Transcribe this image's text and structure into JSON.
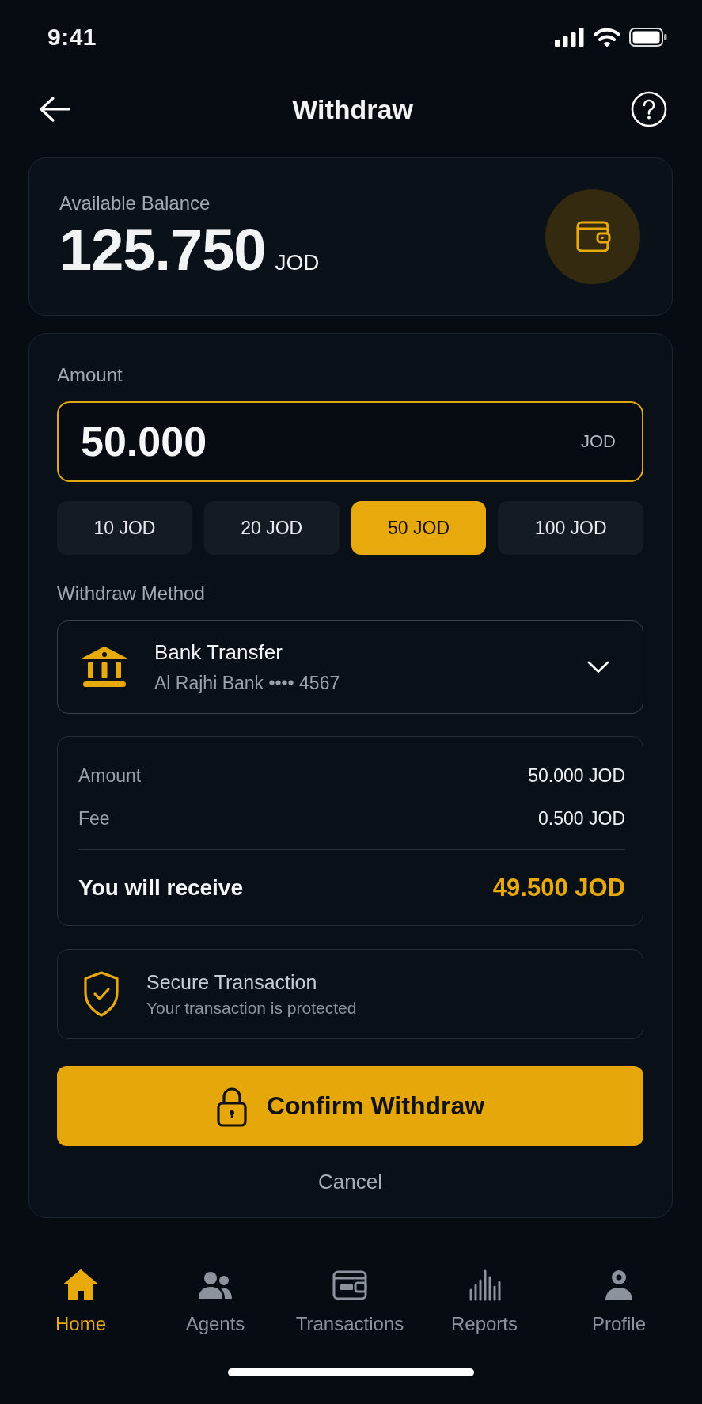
{
  "status_bar": {
    "time": "9:41"
  },
  "header": {
    "title": "Withdraw"
  },
  "balance": {
    "label": "Available Balance",
    "amount": "125.750",
    "currency": "JOD"
  },
  "amount": {
    "label": "Amount",
    "value": "50.000",
    "currency": "JOD"
  },
  "quick_amounts": [
    {
      "label": "10 JOD",
      "selected": false
    },
    {
      "label": "20 JOD",
      "selected": false
    },
    {
      "label": "50 JOD",
      "selected": true
    },
    {
      "label": "100 JOD",
      "selected": false
    }
  ],
  "method": {
    "label": "Withdraw Method",
    "name": "Bank Transfer",
    "account": "Al Rajhi Bank •••• 4567"
  },
  "summary": {
    "rows": [
      {
        "kind": "line",
        "label": "Amount",
        "value": "50.000 JOD"
      },
      {
        "kind": "line",
        "label": "Fee",
        "value": "0.500 JOD"
      },
      {
        "kind": "total",
        "label": "You will receive",
        "value": "49.500 JOD"
      }
    ]
  },
  "security": {
    "title": "Secure Transaction",
    "subtitle": "Your transaction is protected"
  },
  "actions": {
    "confirm": "Confirm Withdraw",
    "cancel": "Cancel"
  },
  "nav": [
    {
      "kind": "home",
      "label": "Home",
      "selected": true
    },
    {
      "kind": "agents",
      "label": "Agents",
      "selected": false
    },
    {
      "kind": "transactions",
      "label": "Transactions",
      "selected": false
    },
    {
      "kind": "reports",
      "label": "Reports",
      "selected": false
    },
    {
      "kind": "profile",
      "label": "Profile",
      "selected": false
    }
  ]
}
